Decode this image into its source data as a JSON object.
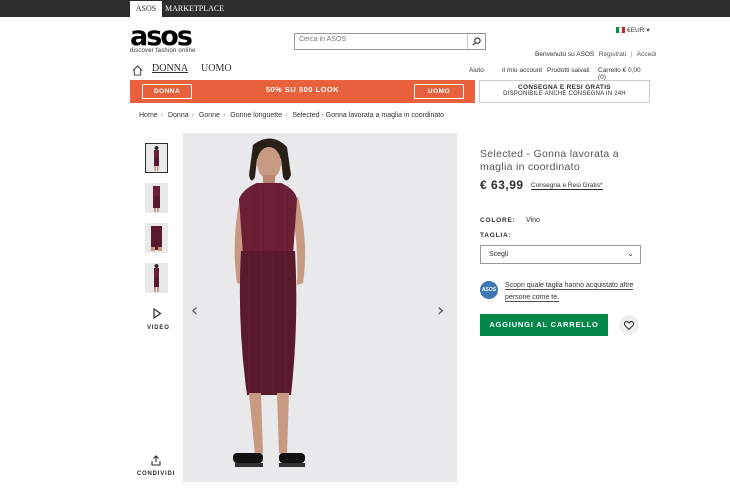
{
  "topbar": {
    "tabs": [
      "ASOS",
      "MARKETPLACE"
    ]
  },
  "header": {
    "logo": "asos",
    "tagline": "discover fashion online",
    "search_placeholder": "Cerca in ASOS",
    "currency": "€EUR",
    "welcome": "Benvenuto su ASOS",
    "register": "Registrati",
    "separator": "|",
    "login": "Accedi"
  },
  "nav": {
    "women": "DONNA",
    "men": "UOMO",
    "links": [
      "Aiuto",
      "Il mio account",
      "Prodotti salvati",
      "Carrello € 0,00 (0)"
    ]
  },
  "promo": {
    "left_button": "DONNA",
    "center": "50% SU 500 LOOK",
    "right_button": "UOMO",
    "shipping_line1": "CONSEGNA E RESI GRATIS",
    "shipping_line2": "DISPONIBILE ANCHE CONSEGNA IN 24H"
  },
  "breadcrumb": [
    "Home",
    "Donna",
    "Gonne",
    "Gonne longuette",
    "Selected - Gonna lavorata a maglia in coordinato"
  ],
  "gallery": {
    "video_label": "VIDEO",
    "share_label": "CONDIVIDI"
  },
  "product": {
    "title": "Selected - Gonna lavorata a maglia in coordinato",
    "price": "€ 63,99",
    "price_note": "Consegna e Resi Gratis*",
    "colour_label": "COLORE:",
    "colour_value": "Vino",
    "size_label": "TAGLIA:",
    "size_value": "Scegli",
    "fit_text": "Scopri quale taglia hanno acquistato altre persone come te.",
    "add_to_cart": "AGGIUNGI AL CARRELLO"
  },
  "colors": {
    "accent_orange": "#e8603c",
    "cart_green": "#018849",
    "garment": "#6b1f36"
  }
}
